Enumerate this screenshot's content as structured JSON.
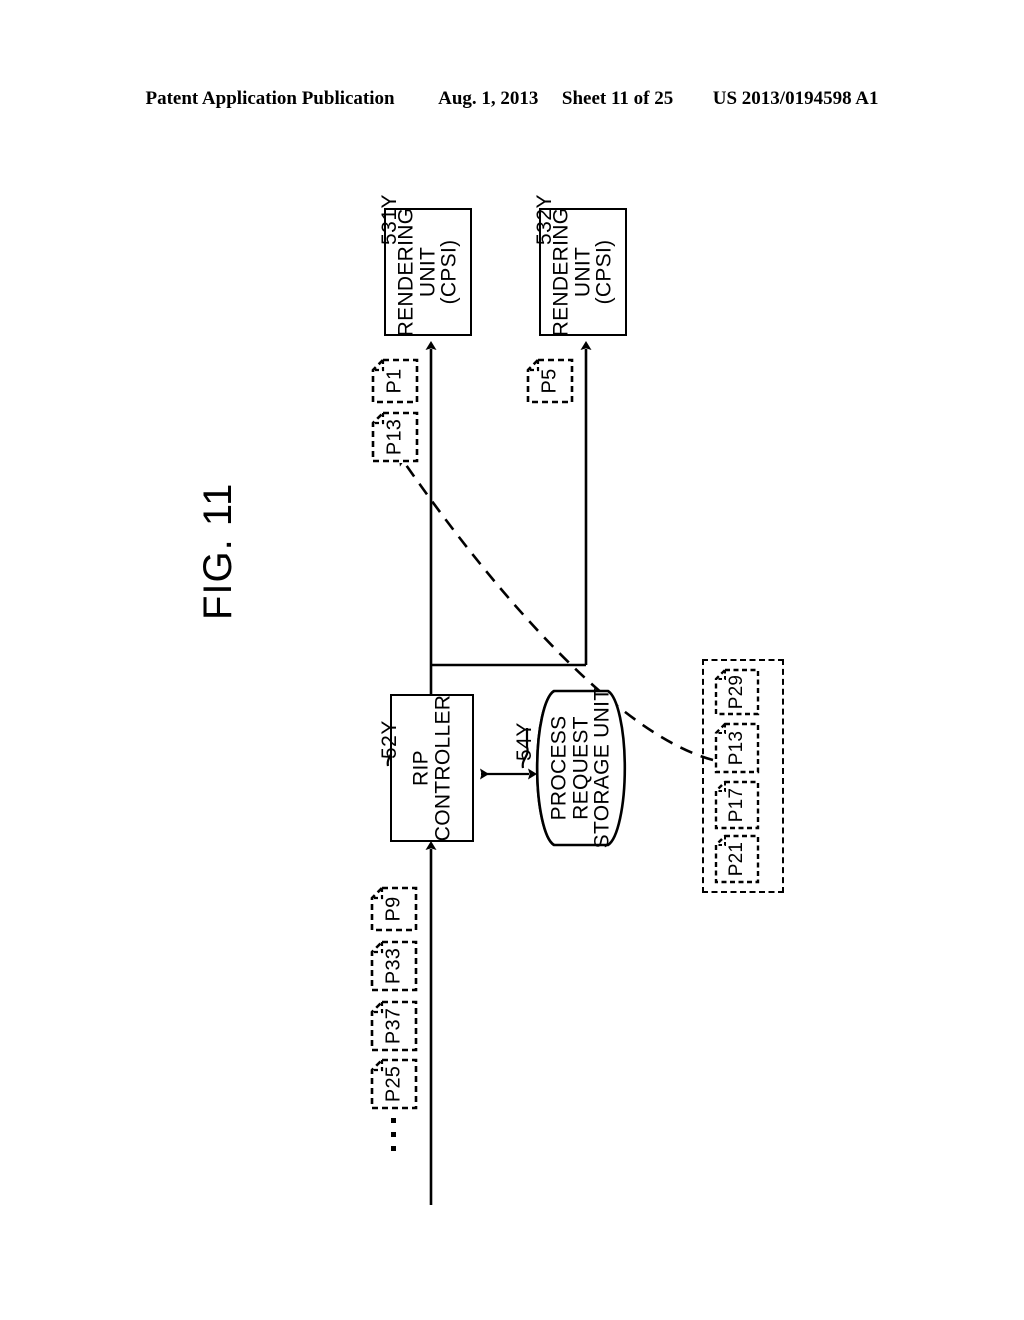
{
  "header": {
    "publication": "Patent Application Publication",
    "date": "Aug. 1, 2013",
    "sheet": "Sheet 11 of 25",
    "number": "US 2013/0194598 A1"
  },
  "figure": {
    "title": "FIG. 11"
  },
  "blocks": {
    "rendering_unit_1": {
      "ref": "531Y",
      "line1": "RENDERING",
      "line2": "UNIT",
      "line3": "(CPSI)"
    },
    "rendering_unit_2": {
      "ref": "532Y",
      "line1": "RENDERING",
      "line2": "UNIT",
      "line3": "(CPSI)"
    },
    "rip_controller": {
      "ref": "52Y",
      "line1": "RIP",
      "line2": "CONTROLLER"
    },
    "process_request_storage_unit": {
      "ref": "54Y",
      "line1": "PROCESS",
      "line2": "REQUEST",
      "line3": "STORAGE UNIT"
    }
  },
  "output_jobs": {
    "unit1": [
      {
        "label": "P1"
      },
      {
        "label": "P13"
      }
    ],
    "unit2": [
      {
        "label": "P5"
      }
    ]
  },
  "queued_jobs": [
    {
      "label": "P29"
    },
    {
      "label": "P13"
    },
    {
      "label": "P17"
    },
    {
      "label": "P21"
    }
  ],
  "input_jobs": [
    {
      "label": "P9"
    },
    {
      "label": "P33"
    },
    {
      "label": "P37"
    },
    {
      "label": "P25"
    }
  ],
  "input_ellipsis": "⋮",
  "colors": {
    "line": "#000000",
    "background": "#ffffff"
  }
}
